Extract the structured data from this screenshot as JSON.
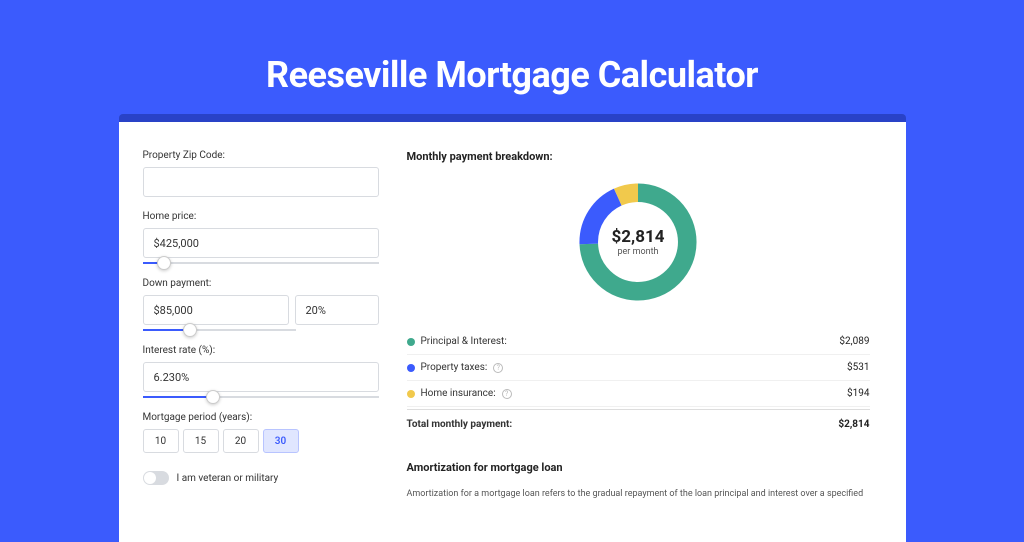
{
  "title": "Reeseville Mortgage Calculator",
  "left": {
    "zip_label": "Property Zip Code:",
    "zip_value": "",
    "home_price_label": "Home price:",
    "home_price_value": "$425,000",
    "home_price_slider_pct": 9,
    "down_payment_label": "Down payment:",
    "down_payment_amount": "$85,000",
    "down_payment_pct": "20%",
    "down_payment_slider_pct": 20,
    "interest_label": "Interest rate (%):",
    "interest_value": "6.230%",
    "interest_slider_pct": 30,
    "period_label": "Mortgage period (years):",
    "periods": [
      "10",
      "15",
      "20",
      "30"
    ],
    "period_active": "30",
    "veteran_label": "I am veteran or military"
  },
  "right": {
    "breakdown_title": "Monthly payment breakdown:",
    "donut_amount": "$2,814",
    "donut_sub": "per month",
    "items": [
      {
        "label": "Principal & Interest:",
        "value": "$2,089",
        "color": "#3fa98d",
        "info": false
      },
      {
        "label": "Property taxes:",
        "value": "$531",
        "color": "#3b5bfd",
        "info": true
      },
      {
        "label": "Home insurance:",
        "value": "$194",
        "color": "#f1c94c",
        "info": true
      }
    ],
    "total_label": "Total monthly payment:",
    "total_value": "$2,814",
    "amort_title": "Amortization for mortgage loan",
    "amort_text": "Amortization for a mortgage loan refers to the gradual repayment of the loan principal and interest over a specified"
  },
  "chart_data": {
    "type": "pie",
    "title": "Monthly payment breakdown",
    "series": [
      {
        "name": "Principal & Interest",
        "value": 2089,
        "color": "#3fa98d"
      },
      {
        "name": "Property taxes",
        "value": 531,
        "color": "#3b5bfd"
      },
      {
        "name": "Home insurance",
        "value": 194,
        "color": "#f1c94c"
      }
    ],
    "total": 2814,
    "center_label": "$2,814 per month"
  }
}
